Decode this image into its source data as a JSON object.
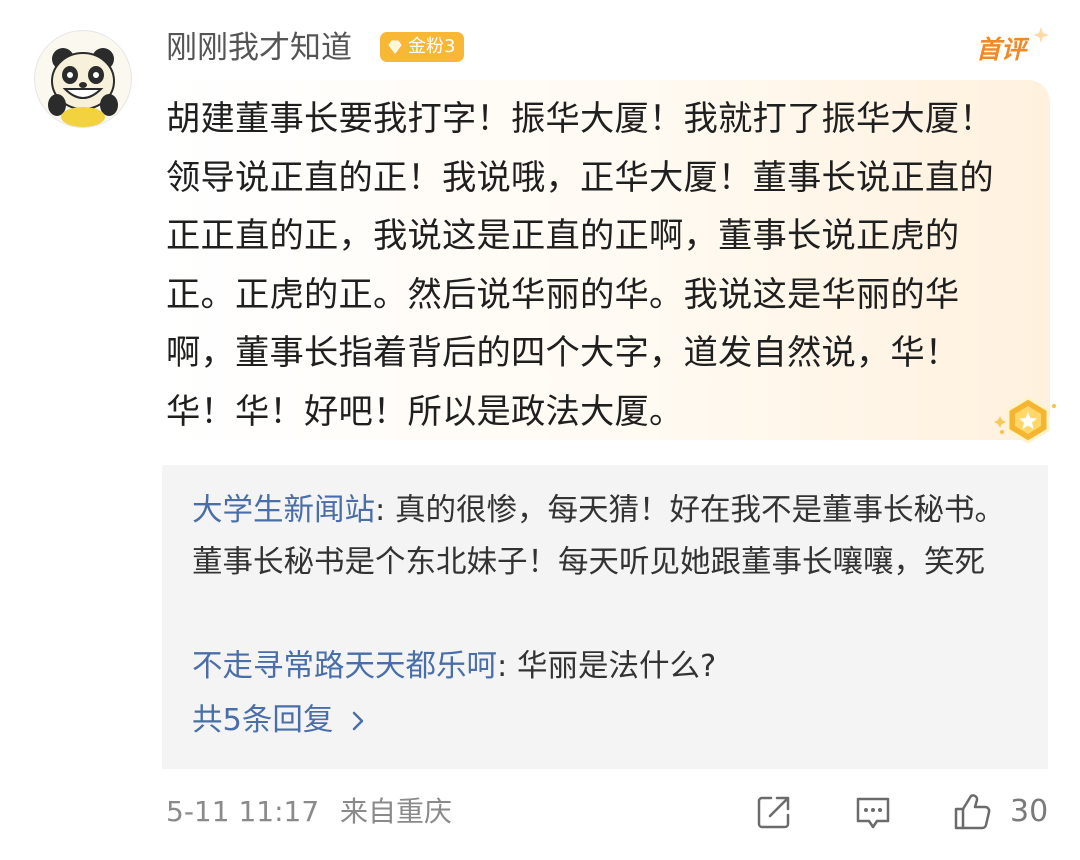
{
  "post": {
    "username": "刚刚我才知道",
    "badge": "金粉3",
    "first_comment_tag": "首评",
    "content": "胡建董事长要我打字！振华大厦！我就打了振华大厦！领导说正直的正！我说哦，正华大厦！董事长说正直的正正直的正，我说这是正直的正啊，董事长说正虎的正。正虎的正。然后说华丽的华。我说这是华丽的华啊，董事长指着背后的四个大字，道发自然说，华！华！华！好吧！所以是政法大厦。"
  },
  "replies": [
    {
      "author": "大学生新闻站",
      "separator": ": ",
      "text": "真的很惨，每天猜！好在我不是董事长秘书。董事长秘书是个东北妹子！每天听见她跟董事长嚷嚷，笑死"
    },
    {
      "author": "不走寻常路天天都乐呵",
      "separator": ": ",
      "text": "华丽是法什么?"
    }
  ],
  "more_replies": "共5条回复",
  "footer": {
    "timestamp": "5-11 11:17",
    "location": "来自重庆",
    "like_count": "30"
  },
  "icons": {
    "avatar": "panda-avatar",
    "badge": "gem-icon",
    "medal": "medal-icon",
    "share": "share-icon",
    "comment": "comment-icon",
    "like": "thumbs-up-icon",
    "more": "chevron-right-icon"
  },
  "colors": {
    "badge_bg": "#f8b735",
    "first_comment": "#f08a26",
    "link": "#4a6fa8",
    "reply_bg": "#f4f4f4"
  }
}
